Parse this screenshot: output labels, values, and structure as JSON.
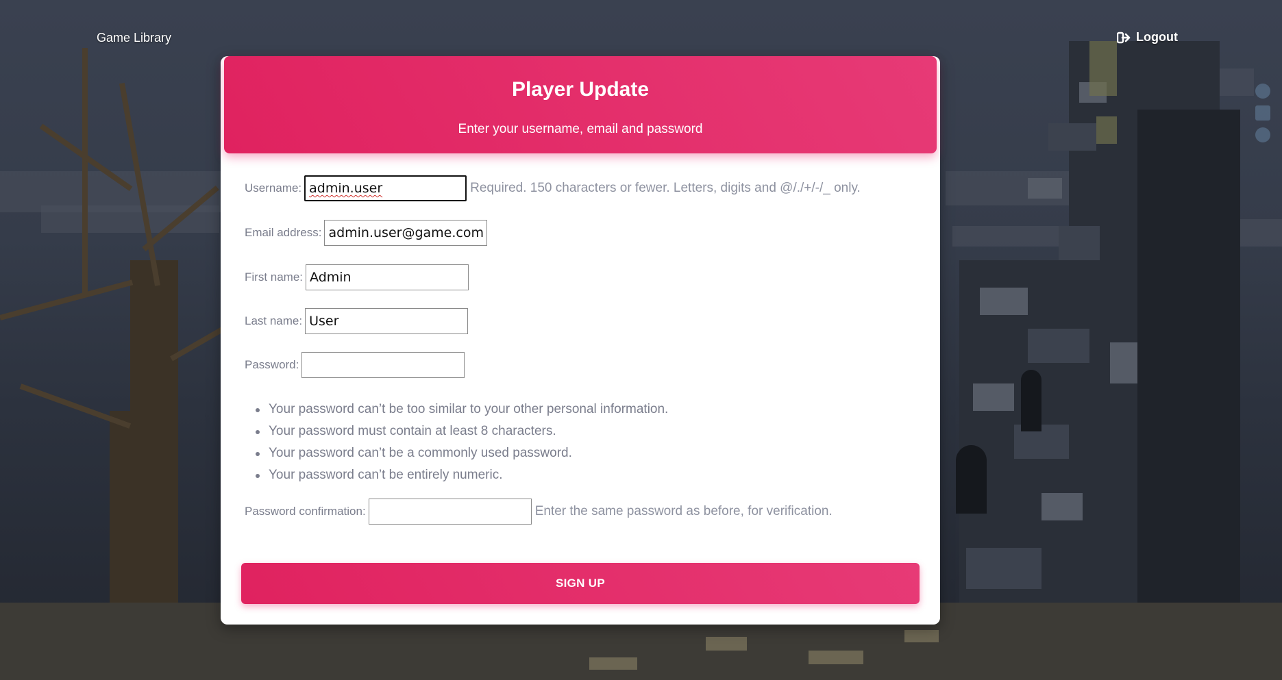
{
  "nav": {
    "brand": "Game Library",
    "logout_label": "Logout",
    "logout_icon": "sign-out-icon"
  },
  "social_icons": [
    "dribbble-icon",
    "linkedin-icon",
    "github-icon"
  ],
  "card": {
    "title": "Player Update",
    "subtitle": "Enter your username, email and password"
  },
  "form": {
    "username": {
      "label": "Username:",
      "value": "admin.user",
      "help": "Required. 150 characters or fewer. Letters, digits and @/./+/-/_ only."
    },
    "email": {
      "label": "Email address:",
      "value": "admin.user@game.com"
    },
    "first_name": {
      "label": "First name:",
      "value": "Admin"
    },
    "last_name": {
      "label": "Last name:",
      "value": "User"
    },
    "password": {
      "label": "Password:",
      "value": ""
    },
    "password_rules": [
      "Your password can’t be too similar to your other personal information.",
      "Your password must contain at least 8 characters.",
      "Your password can’t be a commonly used password.",
      "Your password can’t be entirely numeric."
    ],
    "password_confirmation": {
      "label": "Password confirmation:",
      "value": "",
      "help": "Enter the same password as before, for verification."
    },
    "submit_label": "SIGN UP"
  },
  "colors": {
    "accent": "#e91e63",
    "label_gray": "#7a7d8c",
    "background": "#2f3644"
  }
}
